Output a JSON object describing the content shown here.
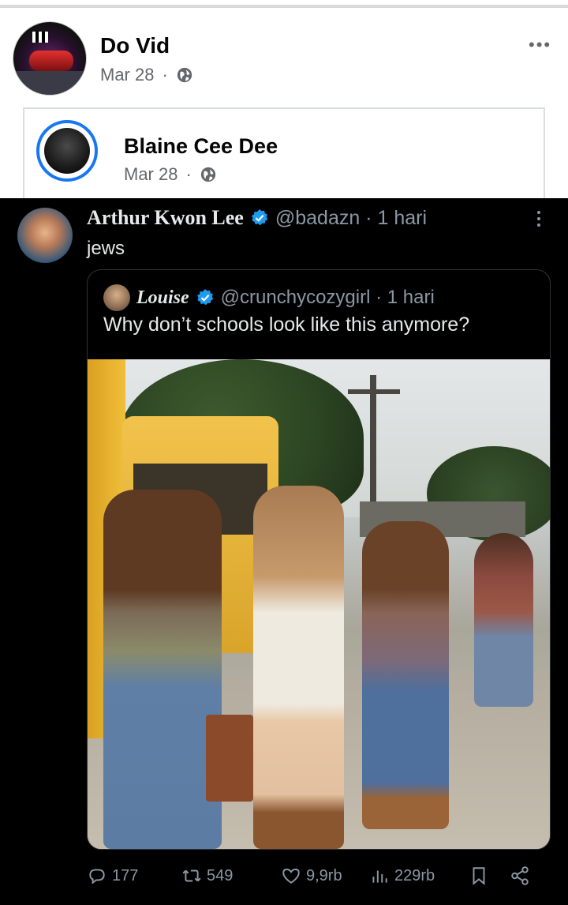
{
  "post": {
    "author": "Do Vid",
    "date": "Mar 28",
    "separator": "·",
    "more_label": "•••"
  },
  "shared_post": {
    "author": "Blaine Cee Dee",
    "date": "Mar 28",
    "separator": "·"
  },
  "tweet": {
    "author": "Arthur Kwon Lee",
    "handle_time": "@badazn · 1 hari",
    "text": "jews",
    "quote": {
      "author": "Louise",
      "handle_time": "@crunchycozygirl · 1 hari",
      "text": "Why don’t schools look like this anymore?"
    },
    "actions": {
      "replies": "177",
      "retweets": "549",
      "likes": "9,9rb",
      "views": "229rb"
    }
  },
  "icons": {
    "globe": "globe-icon",
    "verified": "verified-badge-icon",
    "reply": "reply-icon",
    "retweet": "retweet-icon",
    "like": "heart-icon",
    "views": "views-chart-icon",
    "bookmark": "bookmark-icon",
    "share": "share-icon"
  },
  "colors": {
    "accent_blue": "#1877f2",
    "verified_blue": "#1d9bf0",
    "muted_text": "#65676b",
    "tweet_muted": "#8b98a5"
  }
}
